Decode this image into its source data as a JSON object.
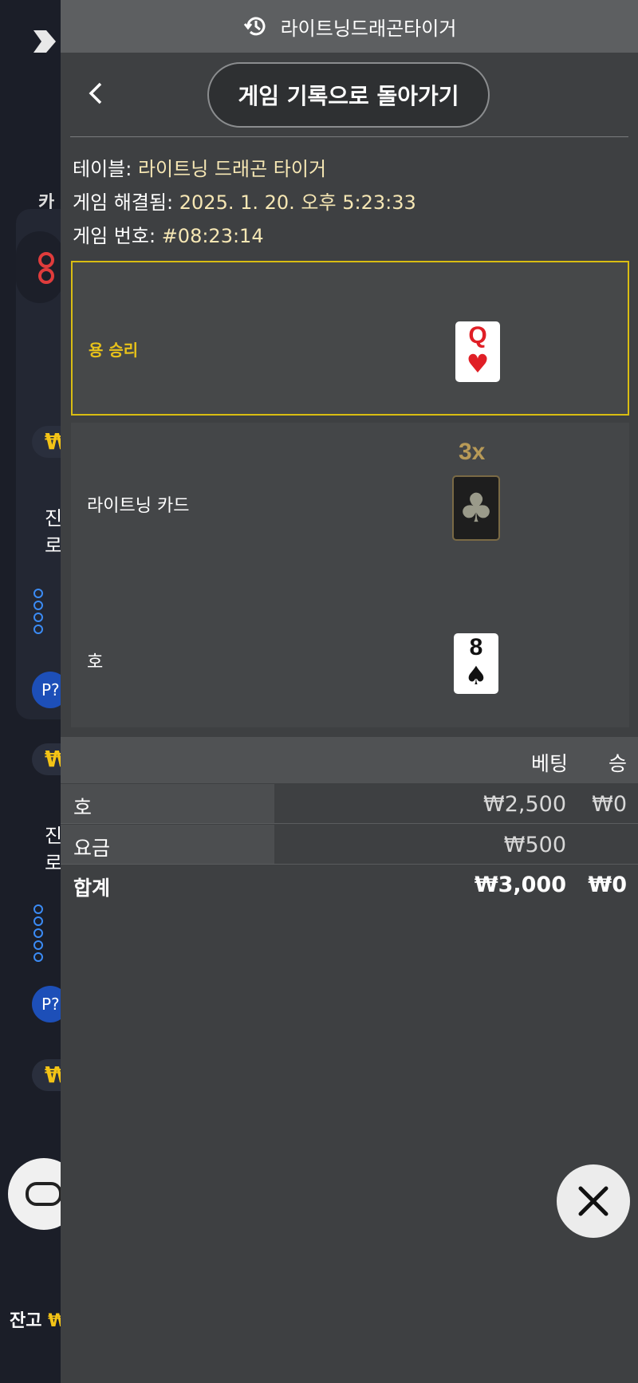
{
  "header": {
    "title": "라이트닝드래곤타이거"
  },
  "nav": {
    "back_label": "게임 기록으로 돌아가기"
  },
  "info": {
    "table_label": "테이블:",
    "table_value": "라이트닝 드래곤 타이거",
    "resolved_label": "게임 해결됨:",
    "resolved_value": "2025. 1. 20. 오후 5:23:33",
    "game_no_label": "게임 번호:",
    "game_no_value": "#08:23:14"
  },
  "outcomes": {
    "winner": {
      "label": "용 승리",
      "card_rank": "Q",
      "card_suit": "♥"
    },
    "lightning": {
      "label": "라이트닝 카드",
      "multiplier": "3x",
      "card_suit": "♣"
    },
    "tiger": {
      "label": "호",
      "card_rank": "8",
      "card_suit": "♠"
    }
  },
  "bets": {
    "col_bet": "베팅",
    "col_win": "승",
    "rows": [
      {
        "label": "호",
        "bet": "₩2,500",
        "win": "₩0"
      },
      {
        "label": "요금",
        "bet": "₩500",
        "win": ""
      }
    ],
    "total": {
      "label": "합계",
      "bet": "₩3,000",
      "win": "₩0"
    }
  },
  "background": {
    "tab": "카",
    "chip": "₩",
    "jin": "진",
    "ro": "로",
    "p_button": "P?",
    "balance_label": "잔고",
    "balance_currency": "₩"
  },
  "colors": {
    "accent_gold": "#e8c21a",
    "panel_bg": "#3e4042",
    "winner_border": "#d9bd12"
  }
}
